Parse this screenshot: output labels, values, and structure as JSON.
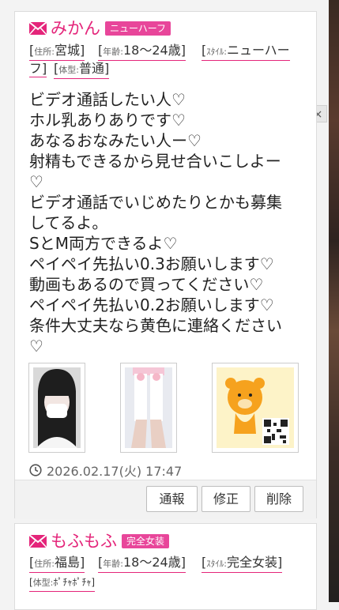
{
  "posts": [
    {
      "name": "みかん",
      "badge": "ニューハーフ",
      "attrs": [
        {
          "label": "住所:",
          "value": "宮城"
        },
        {
          "label": "年齢:",
          "value": "18〜24歳"
        },
        {
          "label": "ｽﾀｲﾙ:",
          "value": "ニューハー"
        },
        {
          "label": "",
          "value": "フ"
        },
        {
          "label": "体型:",
          "value": "普通"
        }
      ],
      "message_lines": [
        "ビデオ通話したい人♡",
        "ホル乳ありありです♡",
        "あなるおなみたい人ー♡",
        "射精もできるから見せ合いこしよー",
        "♡",
        "ビデオ通話でいじめたりとかも募集",
        "してるよ。",
        "SとM両方できるよ♡",
        "ペイペイ先払い0.3お願いします♡",
        "動画もあるので買ってください♡",
        "ペイペイ先払い0.2お願いします♡",
        "条件大丈夫なら黄色に連絡ください",
        "♡"
      ],
      "date": "2026.02.17(火) 17:47",
      "buttons": {
        "report": "通報",
        "edit": "修正",
        "delete": "削除"
      }
    },
    {
      "name": "もふもふ",
      "badge": "完全女装",
      "attrs": [
        {
          "label": "住所:",
          "value": "福島"
        },
        {
          "label": "年齢:",
          "value": "18〜24歳"
        },
        {
          "label": "ｽﾀｲﾙ:",
          "value": "完全女装"
        },
        {
          "label": "体型:",
          "value": "ﾎﾟﾁｬﾎﾟﾁｬ"
        }
      ]
    }
  ],
  "close_label": "×",
  "colors": {
    "accent": "#e4257a",
    "badge": "#e8469a"
  }
}
